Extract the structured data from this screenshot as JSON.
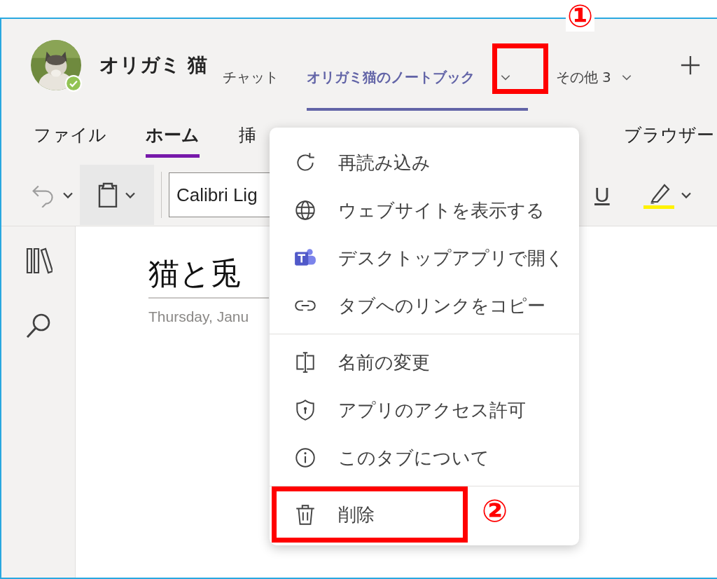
{
  "header": {
    "name": "オリガミ 猫",
    "tabs": [
      {
        "label": "チャット",
        "selected": false,
        "has_menu": false
      },
      {
        "label": "オリガミ猫のノートブック",
        "selected": true,
        "has_menu": true
      },
      {
        "label": "その他 3",
        "selected": false,
        "has_menu": true
      }
    ]
  },
  "ribbon": {
    "tabs": [
      {
        "label": "ファイル",
        "selected": false
      },
      {
        "label": "ホーム",
        "selected": true
      },
      {
        "label": "挿",
        "selected": false
      },
      {
        "label": "ブラウザー",
        "selected": false
      }
    ]
  },
  "toolbar": {
    "font": "Calibri Lig",
    "underline": "U"
  },
  "page": {
    "title": "猫と兎",
    "date": "Thursday, Janu"
  },
  "menu": {
    "groups": [
      [
        {
          "kind": "refresh",
          "label": "再読み込み"
        },
        {
          "kind": "globe",
          "label": "ウェブサイトを表示する"
        },
        {
          "kind": "teams",
          "label": "デスクトップアプリで開く"
        },
        {
          "kind": "link",
          "label": "タブへのリンクをコピー"
        }
      ],
      [
        {
          "kind": "rename",
          "label": "名前の変更"
        },
        {
          "kind": "shield",
          "label": "アプリのアクセス許可"
        },
        {
          "kind": "info",
          "label": "このタブについて"
        }
      ],
      [
        {
          "kind": "trash",
          "label": "削除"
        }
      ]
    ]
  },
  "annotations": [
    {
      "label": "①"
    },
    {
      "label": "②"
    }
  ]
}
